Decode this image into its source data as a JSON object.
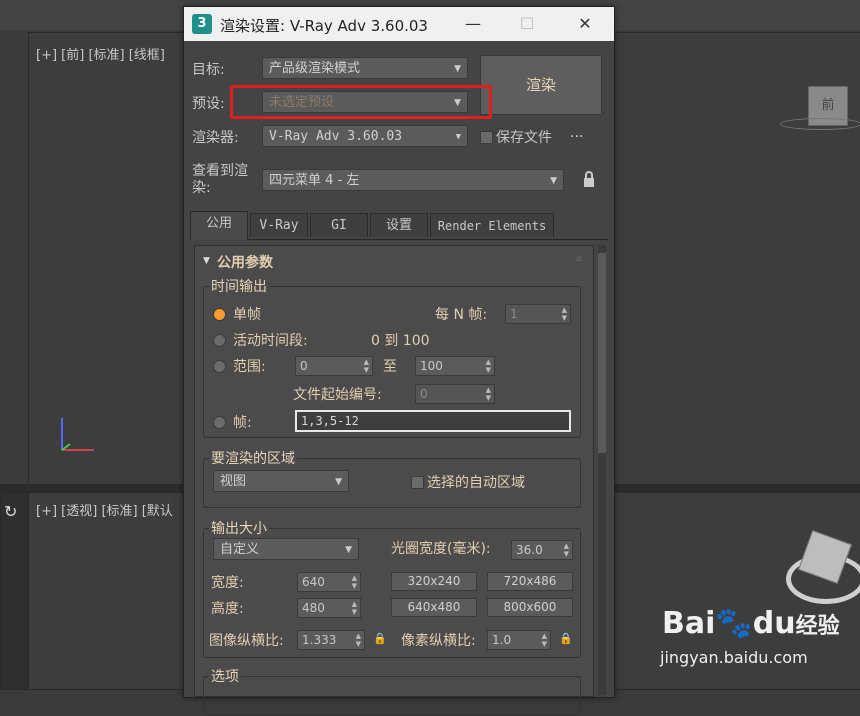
{
  "viewports": {
    "top_left_label": "[+] [前] [标准] [线框]",
    "bottom_left_label": "[+] [透视] [标准] [默认",
    "viewcube_label": "前"
  },
  "dialog": {
    "title": "渲染设置: V-Ray Adv 3.60.03",
    "app_icon": "3",
    "controls": {
      "minimize": "—",
      "maximize": "☐",
      "close": "✕"
    },
    "target_label": "目标:",
    "target_value": "产品级渲染模式",
    "preset_label": "预设:",
    "preset_value": "未选定预设",
    "renderer_label": "渲染器:",
    "renderer_value": "V-Ray Adv 3.60.03",
    "save_file_label": "保存文件",
    "more_label": "...",
    "view_label": "查看到渲染:",
    "view_label_line1": "查看到渲",
    "view_label_line2": "染:",
    "view_value": "四元菜单 4 - 左",
    "render_button": "渲染",
    "tabs": [
      "公用",
      "V-Ray",
      "GI",
      "设置",
      "Render Elements"
    ]
  },
  "common_params": {
    "header": "公用参数",
    "time_output": {
      "title": "时间输出",
      "single": "单帧",
      "every_n": "每 N 帧:",
      "every_n_value": "1",
      "active_segment": "活动时间段:",
      "active_range": "0 到 100",
      "range": "范围:",
      "range_from": "0",
      "range_to_label": "至",
      "range_to": "100",
      "file_start": "文件起始编号:",
      "file_start_value": "0",
      "frames": "帧:",
      "frames_value": "1,3,5-12"
    },
    "area": {
      "title": "要渲染的区域",
      "value": "视图",
      "auto_region": "选择的自动区域"
    },
    "output_size": {
      "title": "输出大小",
      "preset": "自定义",
      "aperture_label": "光圈宽度(毫米):",
      "aperture_value": "36.0",
      "width_label": "宽度:",
      "width_value": "640",
      "height_label": "高度:",
      "height_value": "480",
      "presets": [
        "320x240",
        "720x486",
        "640x480",
        "800x600"
      ],
      "image_aspect_label": "图像纵横比:",
      "image_aspect_value": "1.333",
      "pixel_aspect_label": "像素纵横比:",
      "pixel_aspect_value": "1.0"
    },
    "options": {
      "title": "选项"
    }
  },
  "watermark": {
    "brand_a": "Bai",
    "brand_b": "du",
    "brand_c": "经验",
    "url": "jingyan.baidu.com"
  },
  "colors": {
    "highlight_box": "#e02020",
    "radio_on": "#ff9a2e",
    "label_text": "#e2cfb0"
  }
}
